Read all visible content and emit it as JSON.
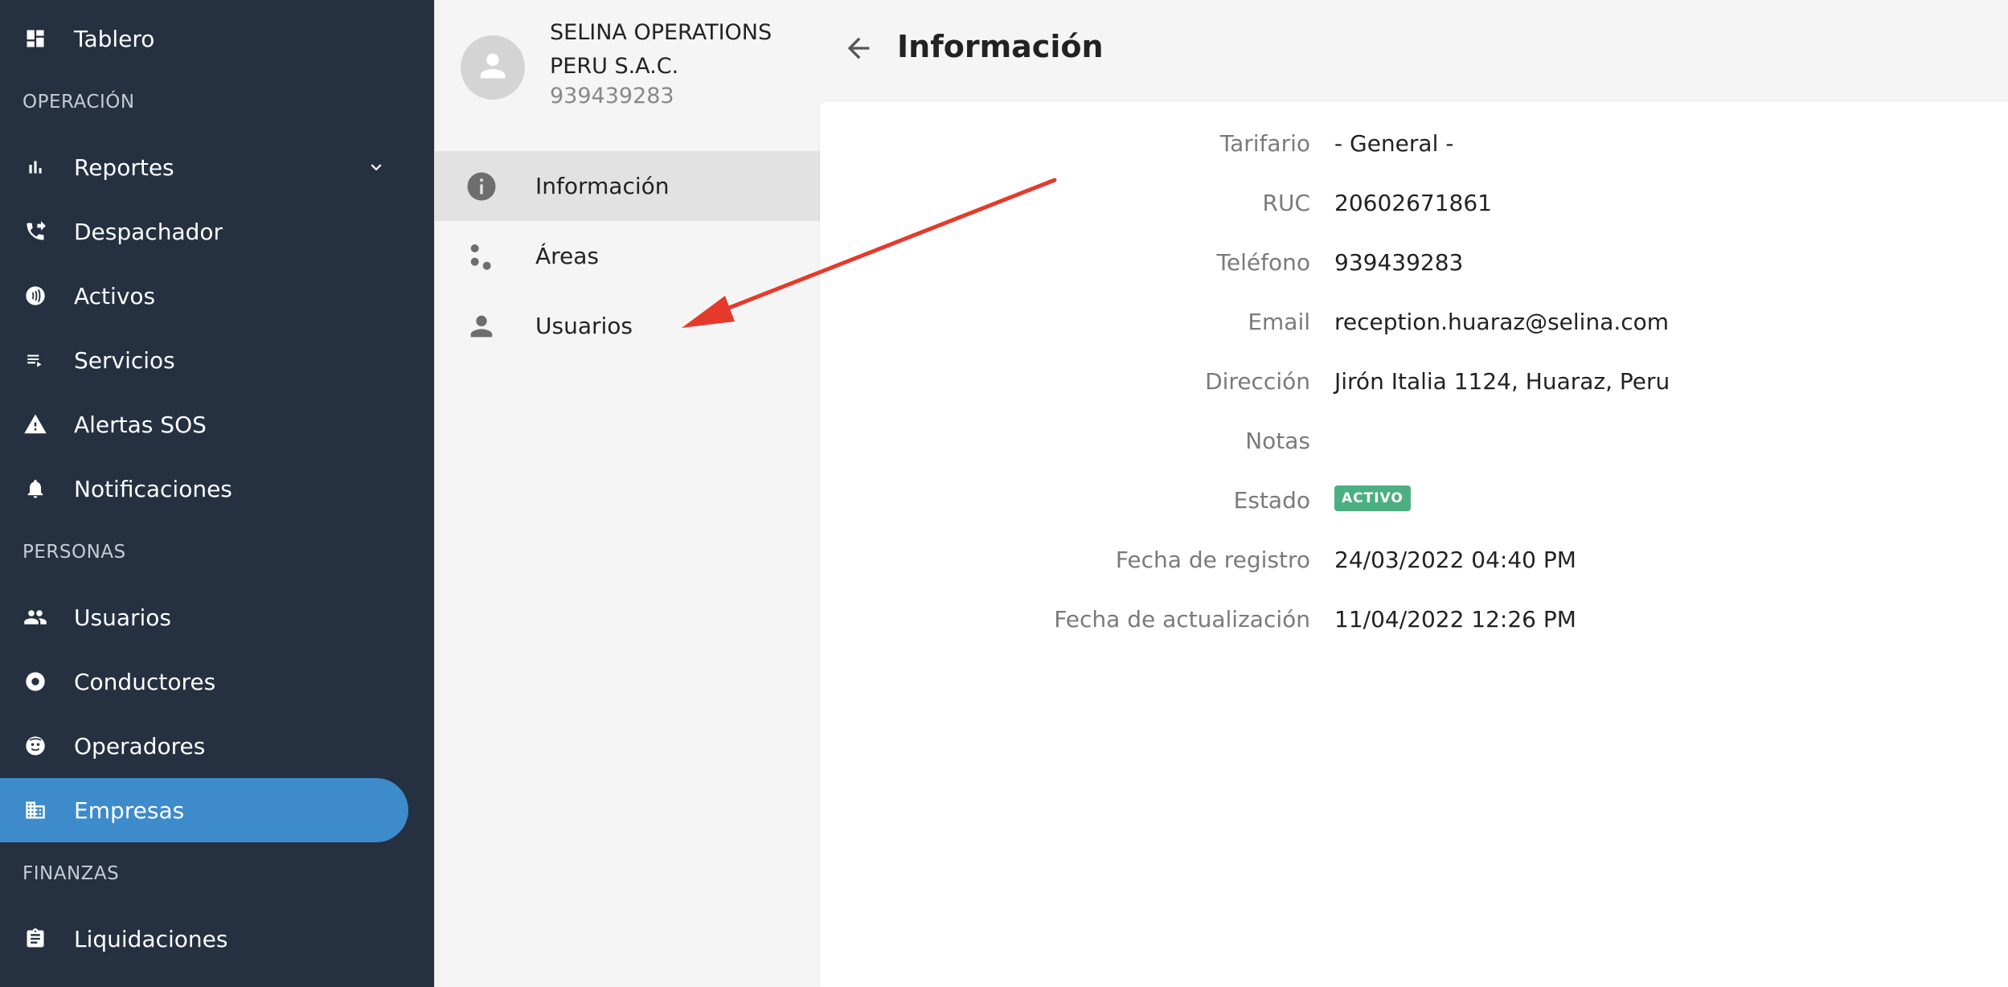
{
  "sidebar": {
    "items": [
      {
        "label": "Tablero",
        "icon": "dashboard-icon"
      },
      {
        "label": "Reportes",
        "icon": "bar-chart-icon"
      },
      {
        "label": "Despachador",
        "icon": "phone-forward-icon"
      },
      {
        "label": "Activos",
        "icon": "nfc-icon"
      },
      {
        "label": "Servicios",
        "icon": "playlist-icon"
      },
      {
        "label": "Alertas SOS",
        "icon": "warning-icon"
      },
      {
        "label": "Notificaciones",
        "icon": "bell-icon"
      },
      {
        "label": "Usuarios",
        "icon": "people-icon"
      },
      {
        "label": "Conductores",
        "icon": "steering-wheel-icon"
      },
      {
        "label": "Operadores",
        "icon": "support-agent-icon"
      },
      {
        "label": "Empresas",
        "icon": "business-icon"
      },
      {
        "label": "Liquidaciones",
        "icon": "clipboard-icon"
      }
    ],
    "sections": {
      "operacion": "OPERACIÓN",
      "personas": "PERSONAS",
      "finanzas": "FINANZAS"
    },
    "active_item": "Empresas"
  },
  "company": {
    "name": "SELINA OPERATIONS PERU S.A.C.",
    "phone": "939439283"
  },
  "subnav": {
    "items": [
      {
        "label": "Información",
        "icon": "info-icon"
      },
      {
        "label": "Áreas",
        "icon": "scatter-dots-icon"
      },
      {
        "label": "Usuarios",
        "icon": "person-icon"
      }
    ],
    "active_item": "Información"
  },
  "header": {
    "title": "Información"
  },
  "details": {
    "rows": [
      {
        "label": "Tarifario",
        "value": "- General -"
      },
      {
        "label": "RUC",
        "value": "20602671861"
      },
      {
        "label": "Teléfono",
        "value": "939439283"
      },
      {
        "label": "Email",
        "value": "reception.huaraz@selina.com"
      },
      {
        "label": "Dirección",
        "value": "Jirón Italia 1124, Huaraz, Peru"
      },
      {
        "label": "Notas",
        "value": ""
      },
      {
        "label": "Estado",
        "value": "ACTIVO"
      },
      {
        "label": "Fecha de registro",
        "value": "24/03/2022 04:40 PM"
      },
      {
        "label": "Fecha de actualización",
        "value": "11/04/2022 12:26 PM"
      }
    ]
  },
  "colors": {
    "sidebar_bg": "#253041",
    "sidebar_active": "#3d8bcb",
    "status_badge": "#4caf82",
    "annotation_arrow": "#e53a2b"
  }
}
